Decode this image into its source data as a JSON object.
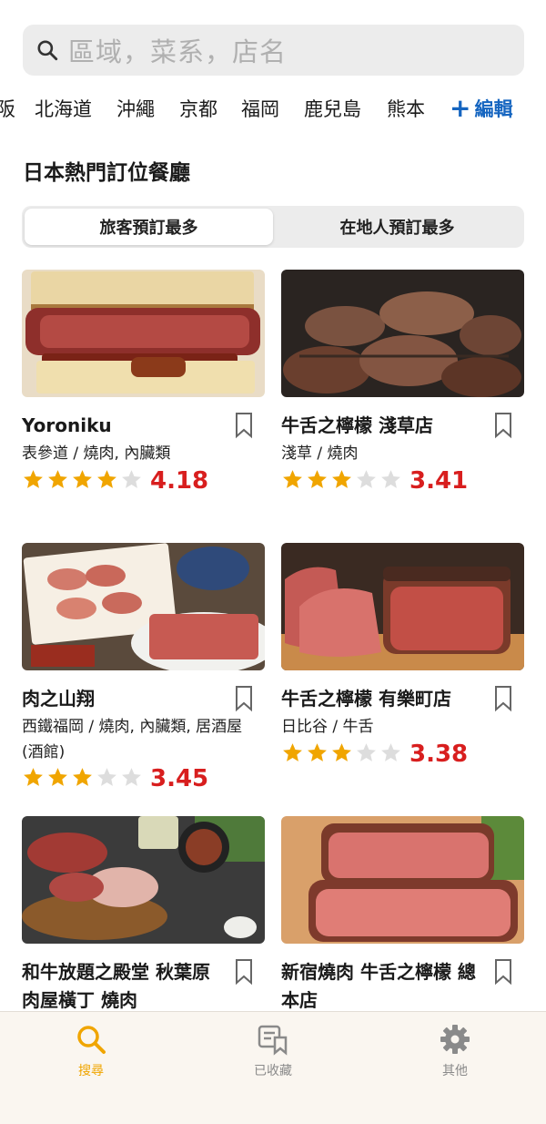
{
  "search": {
    "placeholder": "區域，菜系，店名"
  },
  "regions": {
    "items": [
      "阪",
      "北海道",
      "沖繩",
      "京都",
      "福岡",
      "鹿兒島",
      "熊本"
    ],
    "edit_label": "編輯"
  },
  "section": {
    "title": "日本熱門訂位餐廳"
  },
  "tabs": {
    "tourist": "旅客預訂最多",
    "local": "在地人預訂最多",
    "active": "tourist"
  },
  "restaurants": [
    {
      "name": "Yoroniku",
      "meta": "表參道 / 燒肉, 內臟類",
      "stars": 4,
      "score": "4.18"
    },
    {
      "name": "牛舌之檸檬 淺草店",
      "meta": "淺草 / 燒肉",
      "stars": 3,
      "score": "3.41"
    },
    {
      "name": "肉之山翔",
      "meta": "西鐵福岡 / 燒肉, 內臟類, 居酒屋 (酒館)",
      "stars": 3,
      "score": "3.45"
    },
    {
      "name": "牛舌之檸檬 有樂町店",
      "meta": "日比谷 / 牛舌",
      "stars": 3,
      "score": "3.38"
    },
    {
      "name": "和牛放題之殿堂 秋葉原 肉屋橫丁 燒肉",
      "meta": "",
      "stars": 0,
      "score": ""
    },
    {
      "name": "新宿燒肉 牛舌之檸檬 總本店",
      "meta": "",
      "stars": 0,
      "score": ""
    }
  ],
  "bottom_nav": {
    "search": "搜尋",
    "saved": "已收藏",
    "other": "其他",
    "active": "search"
  },
  "colors": {
    "accent": "#f0a500",
    "score": "#d81e1e",
    "link": "#1565c0"
  }
}
